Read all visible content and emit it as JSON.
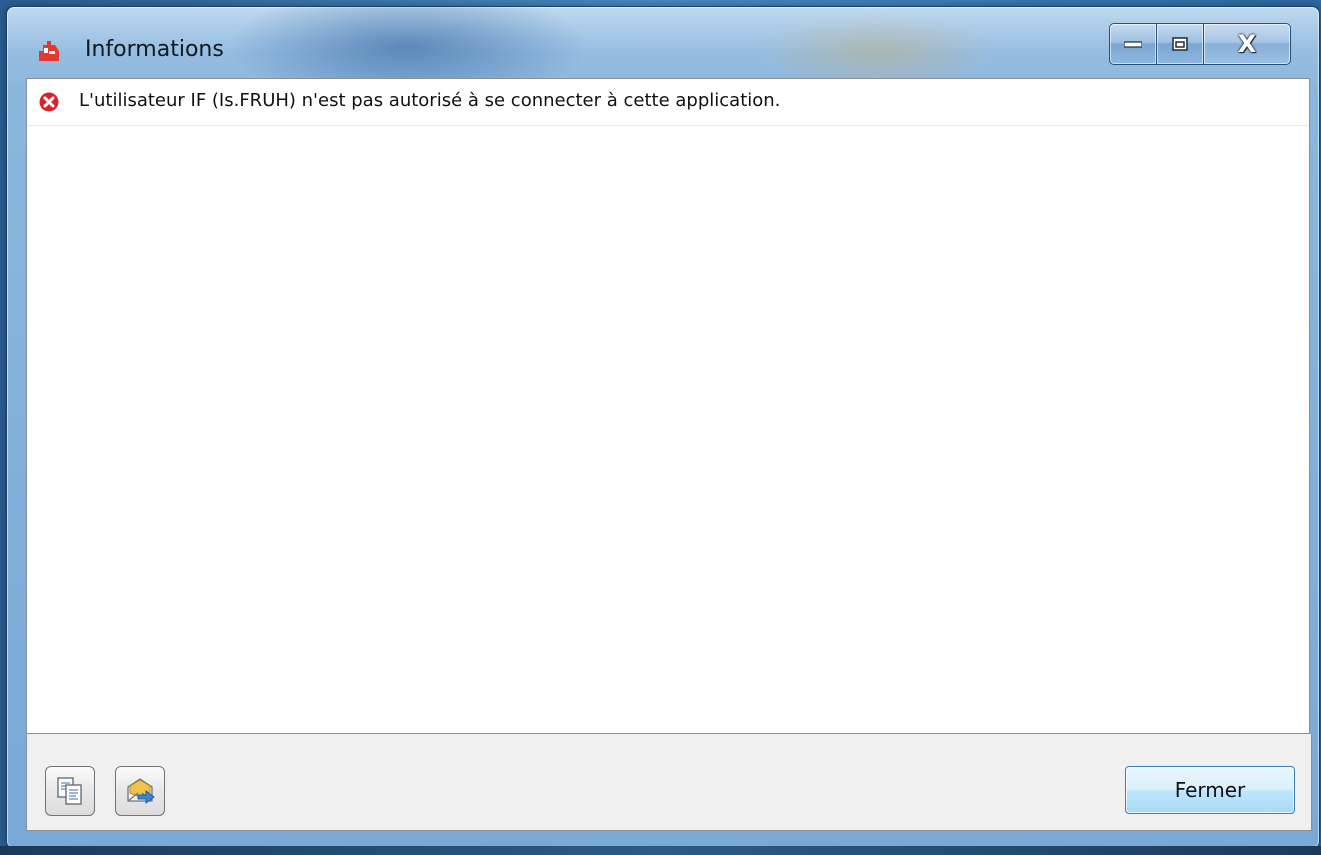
{
  "window": {
    "title": "Informations",
    "caption_buttons": {
      "minimize_icon": "minimize-icon",
      "maximize_icon": "maximize-icon",
      "close_label": "X"
    }
  },
  "messages": [
    {
      "icon": "error-icon",
      "text": "L'utilisateur IF (Is.FRUH) n'est pas autorisé à se connecter à cette application."
    }
  ],
  "footer": {
    "copy_icon": "copy-icon",
    "send_mail_icon": "send-mail-icon",
    "close_button_label": "Fermer"
  },
  "colors": {
    "error_red": "#d6232e",
    "accent_blue": "#3c7fb1",
    "title_bar": "#8bb6de"
  }
}
